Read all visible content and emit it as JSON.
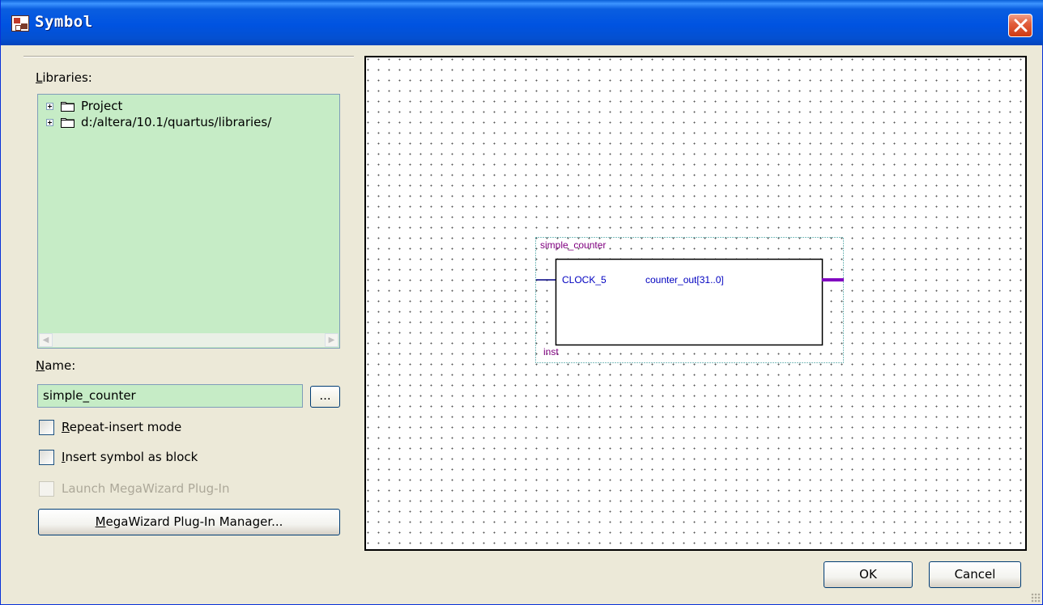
{
  "window": {
    "title": "Symbol",
    "close_icon": "close-icon"
  },
  "libraries": {
    "label": "Libraries:",
    "items": [
      {
        "label": "Project",
        "icon": "folder-icon"
      },
      {
        "label": "d:/altera/10.1/quartus/libraries/",
        "icon": "folder-icon"
      }
    ]
  },
  "name": {
    "label": "Name:",
    "value": "simple_counter",
    "browse_label": "..."
  },
  "options": {
    "repeat_insert": {
      "label": "Repeat-insert mode",
      "checked": false
    },
    "insert_as_block": {
      "label": "Insert symbol as block",
      "checked": false
    },
    "launch_megawizard": {
      "label": "Launch MegaWizard Plug-In",
      "checked": false,
      "enabled": false
    }
  },
  "megawizard_button": {
    "label": "MegaWizard Plug-In Manager..."
  },
  "preview": {
    "symbol_name": "simple_counter",
    "instance_name": "inst",
    "input_port": "CLOCK_5",
    "output_port": "counter_out[31..0]"
  },
  "buttons": {
    "ok": "OK",
    "cancel": "Cancel"
  },
  "colors": {
    "input_fill": "#c6ecc6",
    "symbol_label": "#800080",
    "port_label": "#0000c0",
    "bus": "#8000c0"
  }
}
